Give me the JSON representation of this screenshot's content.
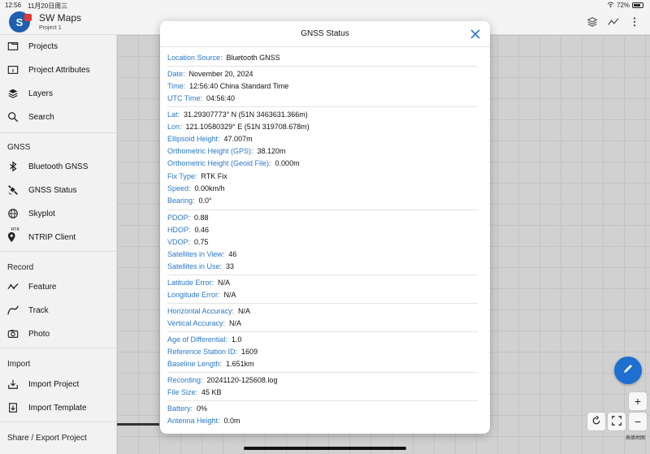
{
  "statusbar": {
    "time": "12:56",
    "date": "11月20日周三",
    "battery": "72%"
  },
  "app": {
    "title": "SW Maps",
    "subtitle": "Project 1",
    "logo_letter": "S"
  },
  "sidebar": {
    "items_top": [
      {
        "label": "Projects",
        "icon": "folder-icon"
      },
      {
        "label": "Project Attributes",
        "icon": "folder-info-icon"
      },
      {
        "label": "Layers",
        "icon": "layers-icon"
      },
      {
        "label": "Search",
        "icon": "search-icon"
      }
    ],
    "gnss_header": "GNSS",
    "gnss_items": [
      {
        "label": "Bluetooth GNSS",
        "icon": "bluetooth-icon"
      },
      {
        "label": "GNSS Status",
        "icon": "satellite-icon"
      },
      {
        "label": "Skyplot",
        "icon": "globe-icon"
      },
      {
        "label": "NTRIP Client",
        "icon": "rtk-pin-icon",
        "badge": "RTK"
      }
    ],
    "record_header": "Record",
    "record_items": [
      {
        "label": "Feature",
        "icon": "polyline-icon"
      },
      {
        "label": "Track",
        "icon": "track-icon"
      },
      {
        "label": "Photo",
        "icon": "camera-icon"
      }
    ],
    "import_header": "Import",
    "import_items": [
      {
        "label": "Import Project",
        "icon": "import-icon"
      },
      {
        "label": "Import Template",
        "icon": "import-template-icon"
      }
    ],
    "share_header": "Share / Export Project"
  },
  "map": {
    "attribution": "高德地图"
  },
  "dialog": {
    "title": "GNSS Status",
    "rows": [
      {
        "label": "Location Source:",
        "value": "Bluetooth GNSS"
      },
      {
        "label": "Date:",
        "value": "November 20, 2024"
      },
      {
        "label": "Time:",
        "value": "12:56:40 China Standard Time"
      },
      {
        "label": "UTC Time:",
        "value": "04:56:40"
      },
      {
        "label": "Lat:",
        "value": "31.29307773° N (51N 3463631.366m)"
      },
      {
        "label": "Lon:",
        "value": "121.10580329° E (51N 319708.678m)"
      },
      {
        "label": "Ellipsoid Height:",
        "value": "47.007m"
      },
      {
        "label": "Orthometric Height (GPS):",
        "value": "38.120m"
      },
      {
        "label": "Orthometric Height (Geoid File):",
        "value": "0.000m"
      },
      {
        "label": "Fix Type:",
        "value": "RTK Fix"
      },
      {
        "label": "Speed:",
        "value": "0.00km/h"
      },
      {
        "label": "Bearing:",
        "value": "0.0°"
      },
      {
        "label": "PDOP:",
        "value": "0.88"
      },
      {
        "label": "HDOP:",
        "value": "0.46"
      },
      {
        "label": "VDOP:",
        "value": "0.75"
      },
      {
        "label": "Satellites in View:",
        "value": "46"
      },
      {
        "label": "Satellites in Use:",
        "value": "33"
      },
      {
        "label": "Latitude Error:",
        "value": "N/A"
      },
      {
        "label": "Longitude Error:",
        "value": "N/A"
      },
      {
        "label": "Horizontal Accuracy:",
        "value": "N/A"
      },
      {
        "label": "Vertical Accuracy:",
        "value": "N/A"
      },
      {
        "label": "Age of Differential:",
        "value": "1.0"
      },
      {
        "label": "Reference Station ID:",
        "value": "1609"
      },
      {
        "label": "Baseline Length:",
        "value": "1.651km"
      },
      {
        "label": "Recording:",
        "value": "20241120-125608.log"
      },
      {
        "label": "File Size:",
        "value": "45 KB"
      },
      {
        "label": "Battery:",
        "value": "0%"
      },
      {
        "label": "Antenna Height:",
        "value": "0.0m"
      }
    ]
  },
  "colors": {
    "accent": "#2a78c8",
    "fab": "#1e6fd0",
    "logo": "#1f5fb0"
  }
}
